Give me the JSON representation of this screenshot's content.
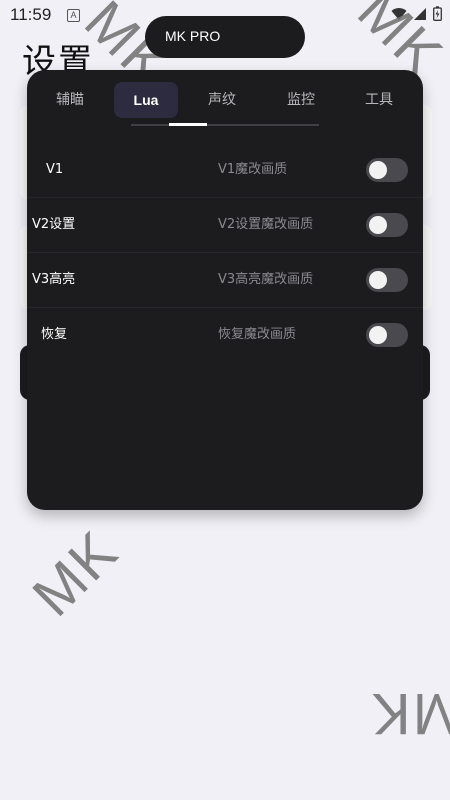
{
  "status_bar": {
    "time": "11:59",
    "notification_icon": "A"
  },
  "page_title": "设置",
  "watermark_text": "MK",
  "window": {
    "title": "MK PRO"
  },
  "tabs": [
    {
      "label": "辅瞄",
      "active": false
    },
    {
      "label": "Lua",
      "active": true
    },
    {
      "label": "声纹",
      "active": false
    },
    {
      "label": "监控",
      "active": false
    },
    {
      "label": "工具",
      "active": false
    }
  ],
  "settings": [
    {
      "label": "V1",
      "description": "V1魔改画质",
      "enabled": false
    },
    {
      "label": "V2设置",
      "description": "V2设置魔改画质",
      "enabled": false
    },
    {
      "label": "V3高亮",
      "description": "V3高亮魔改画质",
      "enabled": false
    },
    {
      "label": "恢复",
      "description": "恢复魔改画质",
      "enabled": false
    }
  ],
  "colors": {
    "panel": "#1c1c1e",
    "active_tab": "#2c2b40",
    "background": "#f1f0f6"
  }
}
